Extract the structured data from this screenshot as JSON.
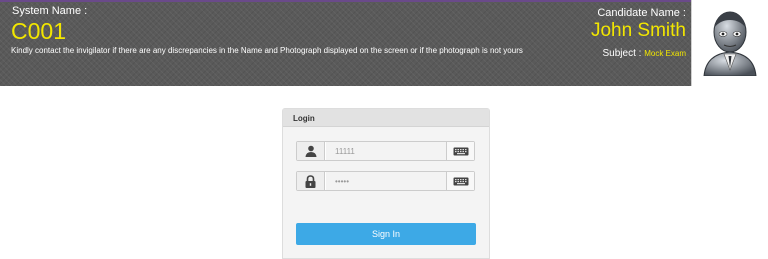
{
  "header": {
    "system_label": "System Name :",
    "system_name": "C001",
    "notice": "Kindly contact the invigilator if there are any discrepancies in the Name and Photograph displayed on the screen or if the photograph is not yours",
    "candidate_label": "Candidate Name :",
    "candidate_name": "John Smith",
    "subject_label": "Subject :",
    "subject_value": "Mock Exam"
  },
  "login": {
    "title": "Login",
    "username_value": "11111",
    "password_value": "•••••",
    "sign_in_label": "Sign In"
  },
  "colors": {
    "accent_yellow": "#f2e600",
    "button_blue": "#3da9e6",
    "header_gray": "#5a5a5a"
  },
  "icons": [
    "user-icon",
    "lock-icon",
    "keyboard-icon",
    "candidate-photo-avatar"
  ]
}
